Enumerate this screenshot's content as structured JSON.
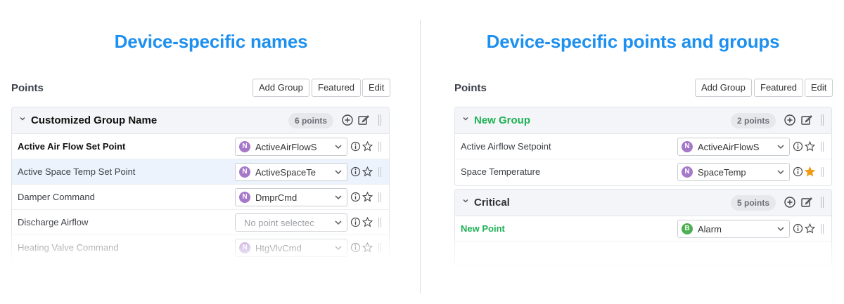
{
  "left": {
    "heading": "Device-specific names",
    "points_label": "Points",
    "buttons": {
      "add_group": "Add Group",
      "featured": "Featured",
      "edit": "Edit"
    },
    "group": {
      "name": "Customized Group Name",
      "count": "6 points"
    },
    "rows": [
      {
        "label": "Active Air Flow Set Point",
        "badge": "N",
        "value": "ActiveAirFlowS"
      },
      {
        "label": "Active Space Temp Set Point",
        "badge": "N",
        "value": "ActiveSpaceTe"
      },
      {
        "label": "Damper Command",
        "badge": "N",
        "value": "DmprCmd"
      },
      {
        "label": "Discharge Airflow",
        "placeholder": "No point selectec"
      },
      {
        "label": "Heating Valve Command",
        "badge": "N",
        "value": "HtgVlvCmd"
      }
    ]
  },
  "right": {
    "heading": "Device-specific points and groups",
    "points_label": "Points",
    "buttons": {
      "add_group": "Add Group",
      "featured": "Featured",
      "edit": "Edit"
    },
    "group1": {
      "name": "New Group",
      "count": "2 points"
    },
    "group1_rows": [
      {
        "label": "Active Airflow Setpoint",
        "badge": "N",
        "value": "ActiveAirFlowS"
      },
      {
        "label": "Space Temperature",
        "badge": "N",
        "value": "SpaceTemp",
        "featured": true
      }
    ],
    "group2": {
      "name": "Critical",
      "count": "5 points"
    },
    "group2_rows": [
      {
        "label": "New Point",
        "badge": "B",
        "value": "Alarm"
      }
    ]
  },
  "colors": {
    "heading": "#1e90ef",
    "green": "#1fb155",
    "star_active": "#f39c12",
    "badge_n": "#a678c9",
    "badge_b": "#4caf50"
  }
}
